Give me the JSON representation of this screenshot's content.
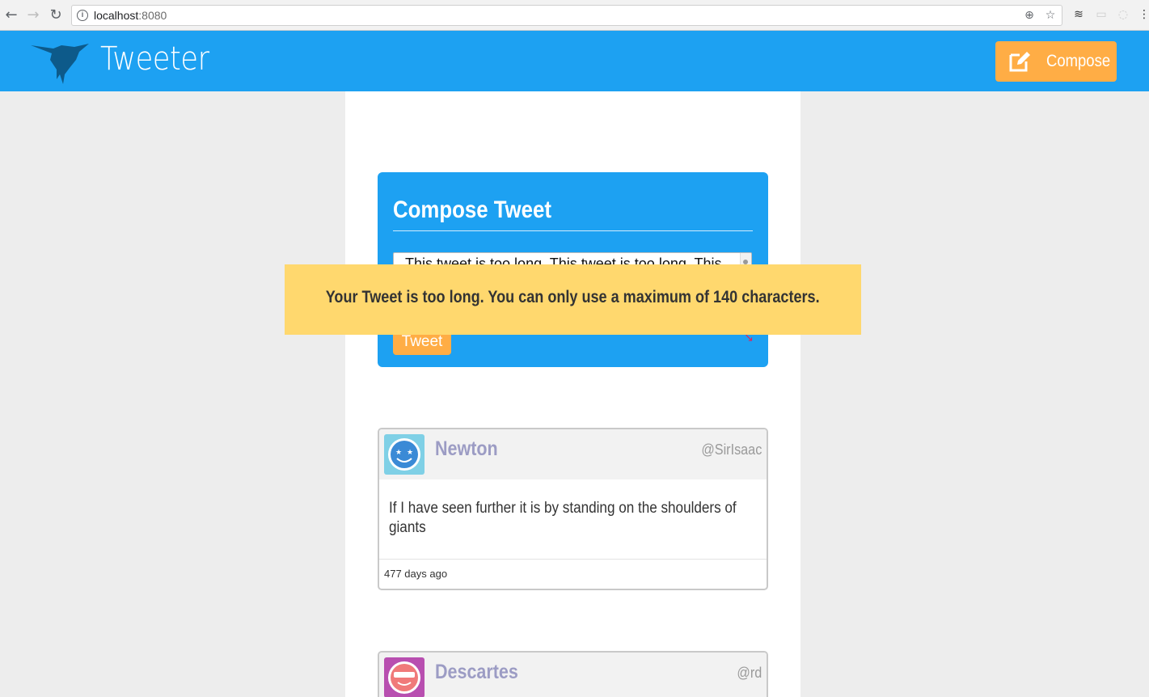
{
  "browser": {
    "url_host": "localhost",
    "url_port": ":8080",
    "icons": {
      "back": "arrow-left-icon",
      "forward": "arrow-right-icon",
      "reload": "reload-icon",
      "site_info": "info-icon",
      "zoom": "zoom-icon",
      "bookmark": "star-icon",
      "extensions": [
        "layers-icon",
        "extension-box-icon",
        "extension-circle-icon",
        "menu-icon"
      ]
    }
  },
  "header": {
    "brand": "Tweeter",
    "compose_label": "Compose",
    "logo_icon": "hummingbird-icon",
    "compose_icon": "pencil-square-icon",
    "colors": {
      "bar": "#1da1f2",
      "button": "#ffad45"
    }
  },
  "compose": {
    "title": "Compose Tweet",
    "textarea_value": "This tweet is too long. This tweet is too long. This",
    "submit_label": "Tweet"
  },
  "error": {
    "message": "Your Tweet is too long. You can only use a maximum of 140 characters.",
    "color": "#ffd86e"
  },
  "tweets": [
    {
      "name": "Newton",
      "handle": "@SirIsaac",
      "text": "If I have seen further it is by standing on the shoulders of giants",
      "age": "477 days ago",
      "avatar_icon": "smiley-star-eyes-avatar"
    },
    {
      "name": "Descartes",
      "handle": "@rd",
      "avatar_icon": "smiley-sunglasses-avatar"
    }
  ]
}
